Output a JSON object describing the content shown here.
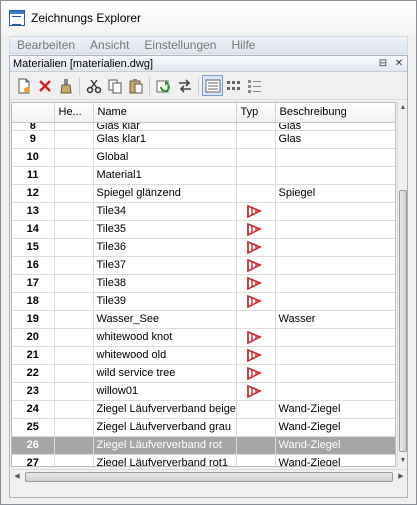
{
  "window": {
    "title": "Zeichnungs Explorer"
  },
  "menu": [
    "Bearbeiten",
    "Ansicht",
    "Einstellungen",
    "Hilfe"
  ],
  "panel": {
    "title": "Materialien [materialien.dwg]",
    "pin_symbol": "⊟",
    "close_symbol": "✕"
  },
  "toolbar": [
    {
      "name": "new-material-icon"
    },
    {
      "name": "delete-icon"
    },
    {
      "name": "purge-brush-icon"
    },
    {
      "sep": true
    },
    {
      "name": "cut-icon"
    },
    {
      "name": "copy-icon"
    },
    {
      "name": "paste-icon"
    },
    {
      "sep": true
    },
    {
      "name": "refresh-icon"
    },
    {
      "name": "swap-arrows-icon"
    },
    {
      "sep": true
    },
    {
      "name": "details-view-icon",
      "active": true
    },
    {
      "name": "large-icons-view-icon"
    },
    {
      "name": "list-view-icon"
    }
  ],
  "table": {
    "columns": [
      "",
      "He...",
      "Name",
      "Typ",
      "Beschreibung"
    ],
    "partial_row": {
      "num": "8",
      "name": "Glas klar",
      "desc": "Glas"
    },
    "rows": [
      {
        "num": "9",
        "name": "Glas klar1",
        "type_icon": false,
        "desc": "Glas"
      },
      {
        "num": "10",
        "name": "Global",
        "type_icon": false,
        "desc": ""
      },
      {
        "num": "11",
        "name": "Material1",
        "type_icon": false,
        "desc": ""
      },
      {
        "num": "12",
        "name": "Spiegel glänzend",
        "type_icon": false,
        "desc": "Spiegel"
      },
      {
        "num": "13",
        "name": "Tile34",
        "type_icon": true,
        "desc": ""
      },
      {
        "num": "14",
        "name": "Tile35",
        "type_icon": true,
        "desc": ""
      },
      {
        "num": "15",
        "name": "Tile36",
        "type_icon": true,
        "desc": ""
      },
      {
        "num": "16",
        "name": "Tile37",
        "type_icon": true,
        "desc": ""
      },
      {
        "num": "17",
        "name": "Tile38",
        "type_icon": true,
        "desc": ""
      },
      {
        "num": "18",
        "name": "Tile39",
        "type_icon": true,
        "desc": ""
      },
      {
        "num": "19",
        "name": "Wasser_See",
        "type_icon": false,
        "desc": "Wasser"
      },
      {
        "num": "20",
        "name": "whitewood knot",
        "type_icon": true,
        "desc": ""
      },
      {
        "num": "21",
        "name": "whitewood old",
        "type_icon": true,
        "desc": ""
      },
      {
        "num": "22",
        "name": "wild service tree",
        "type_icon": true,
        "desc": ""
      },
      {
        "num": "23",
        "name": "willow01",
        "type_icon": true,
        "desc": ""
      },
      {
        "num": "24",
        "name": "Ziegel Läufververband beige",
        "type_icon": false,
        "desc": "Wand-Ziegel"
      },
      {
        "num": "25",
        "name": "Ziegel Läufververband grau",
        "type_icon": false,
        "desc": "Wand-Ziegel"
      },
      {
        "num": "26",
        "name": "Ziegel Läufververband rot",
        "type_icon": false,
        "desc": "Wand-Ziegel",
        "selected": true
      },
      {
        "num": "27",
        "name": "Ziegel Läufververband rot1",
        "type_icon": false,
        "desc": "Wand-Ziegel"
      }
    ]
  },
  "colors": {
    "selection": "#a6a6a6",
    "type_icon": "#c8282d"
  }
}
